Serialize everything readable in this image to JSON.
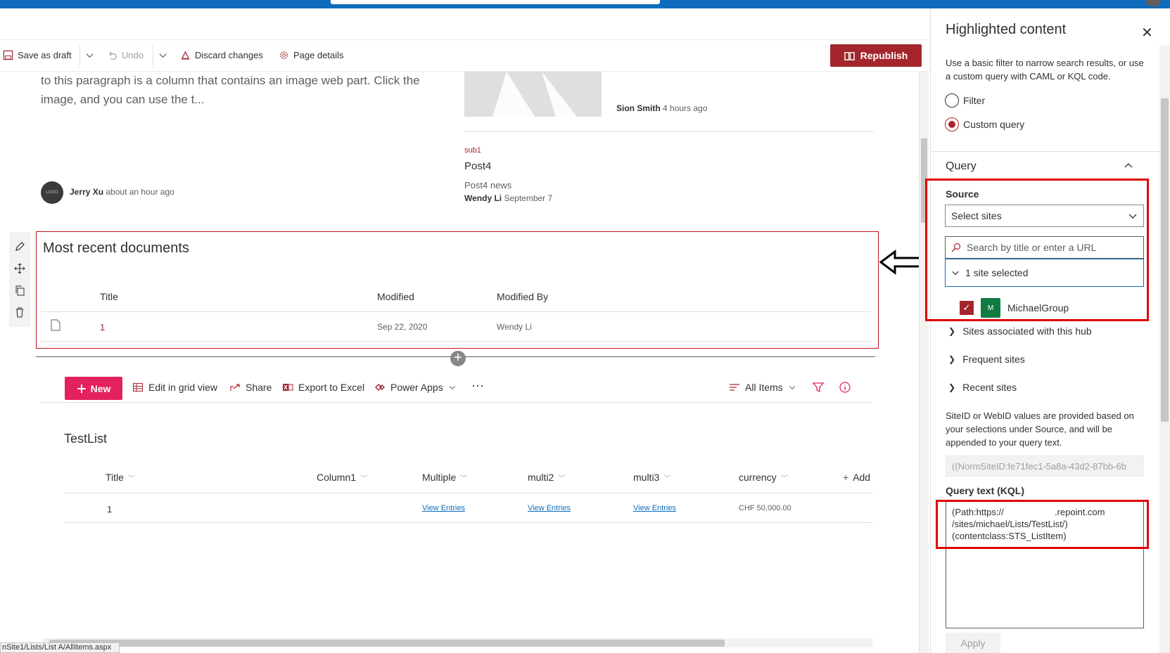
{
  "toolbar": {
    "save_draft": "Save as draft",
    "undo": "Undo",
    "discard": "Discard changes",
    "page_details": "Page details",
    "republish": "Republish"
  },
  "news": {
    "paragraph": "to this paragraph is a column that contains an image web part. Click the image, and you can use the t...",
    "item1_author": "Sion Smith",
    "item1_time": "4 hours ago",
    "item2_tag": "sub1",
    "item2_title": "Post4",
    "item2_desc": "Post4 news",
    "item2_author": "Wendy Li",
    "item2_time": "September 7",
    "item3_author": "Jerry Xu",
    "item3_time": "about an hour ago",
    "logo_text": "LOGO"
  },
  "documents": {
    "title": "Most recent documents",
    "headers": [
      "Title",
      "Modified",
      "Modified By"
    ],
    "rows": [
      {
        "title": "1",
        "modified": "Sep 22, 2020",
        "modified_by": "Wendy Li"
      }
    ]
  },
  "list_toolbar": {
    "new": "New",
    "edit_grid": "Edit in grid view",
    "share": "Share",
    "export": "Export to Excel",
    "power_apps": "Power Apps",
    "more": "···",
    "view": "All Items"
  },
  "list": {
    "name": "TestList",
    "columns": [
      "Title",
      "Column1",
      "Multiple",
      "multi2",
      "multi3",
      "currency",
      "Add"
    ],
    "row": {
      "title": "1",
      "multiple": "View Entries",
      "multi2": "View Entries",
      "multi3": "View Entries",
      "currency": "CHF 50,000.00"
    }
  },
  "status_url": "nSite1/Lists/List A/AllItems.aspx",
  "panel": {
    "title": "Highlighted content",
    "description": "Use a basic filter to narrow search results, or use a custom query with CAML or KQL code.",
    "radio_filter": "Filter",
    "radio_custom": "Custom query",
    "query_section": "Query",
    "source_label": "Source",
    "source_value": "Select sites",
    "search_placeholder": "Search by title or enter a URL",
    "selected_count": "1 site selected",
    "selected_site": "MichaelGroup",
    "site_initial": "M",
    "tree_hub": "Sites associated with this hub",
    "tree_frequent": "Frequent sites",
    "tree_recent": "Recent sites",
    "siteid_note": "SiteID or WebID values are provided based on your selections under Source, and will be appended to your query text.",
    "siteid_value": "((NormSiteID:fe71fec1-5a8a-43d2-87bb-6b",
    "query_label": "Query text (KQL)",
    "query_text": "(Path:https://                    .repoint.com\n/sites/michael/Lists/TestList/)\n(contentclass:STS_ListItem)",
    "apply": "Apply"
  },
  "colors": {
    "accent": "#a4262c",
    "brand_blue": "#0f6cbd",
    "new_button": "#e3215d",
    "highlight_box": "#e00000"
  }
}
